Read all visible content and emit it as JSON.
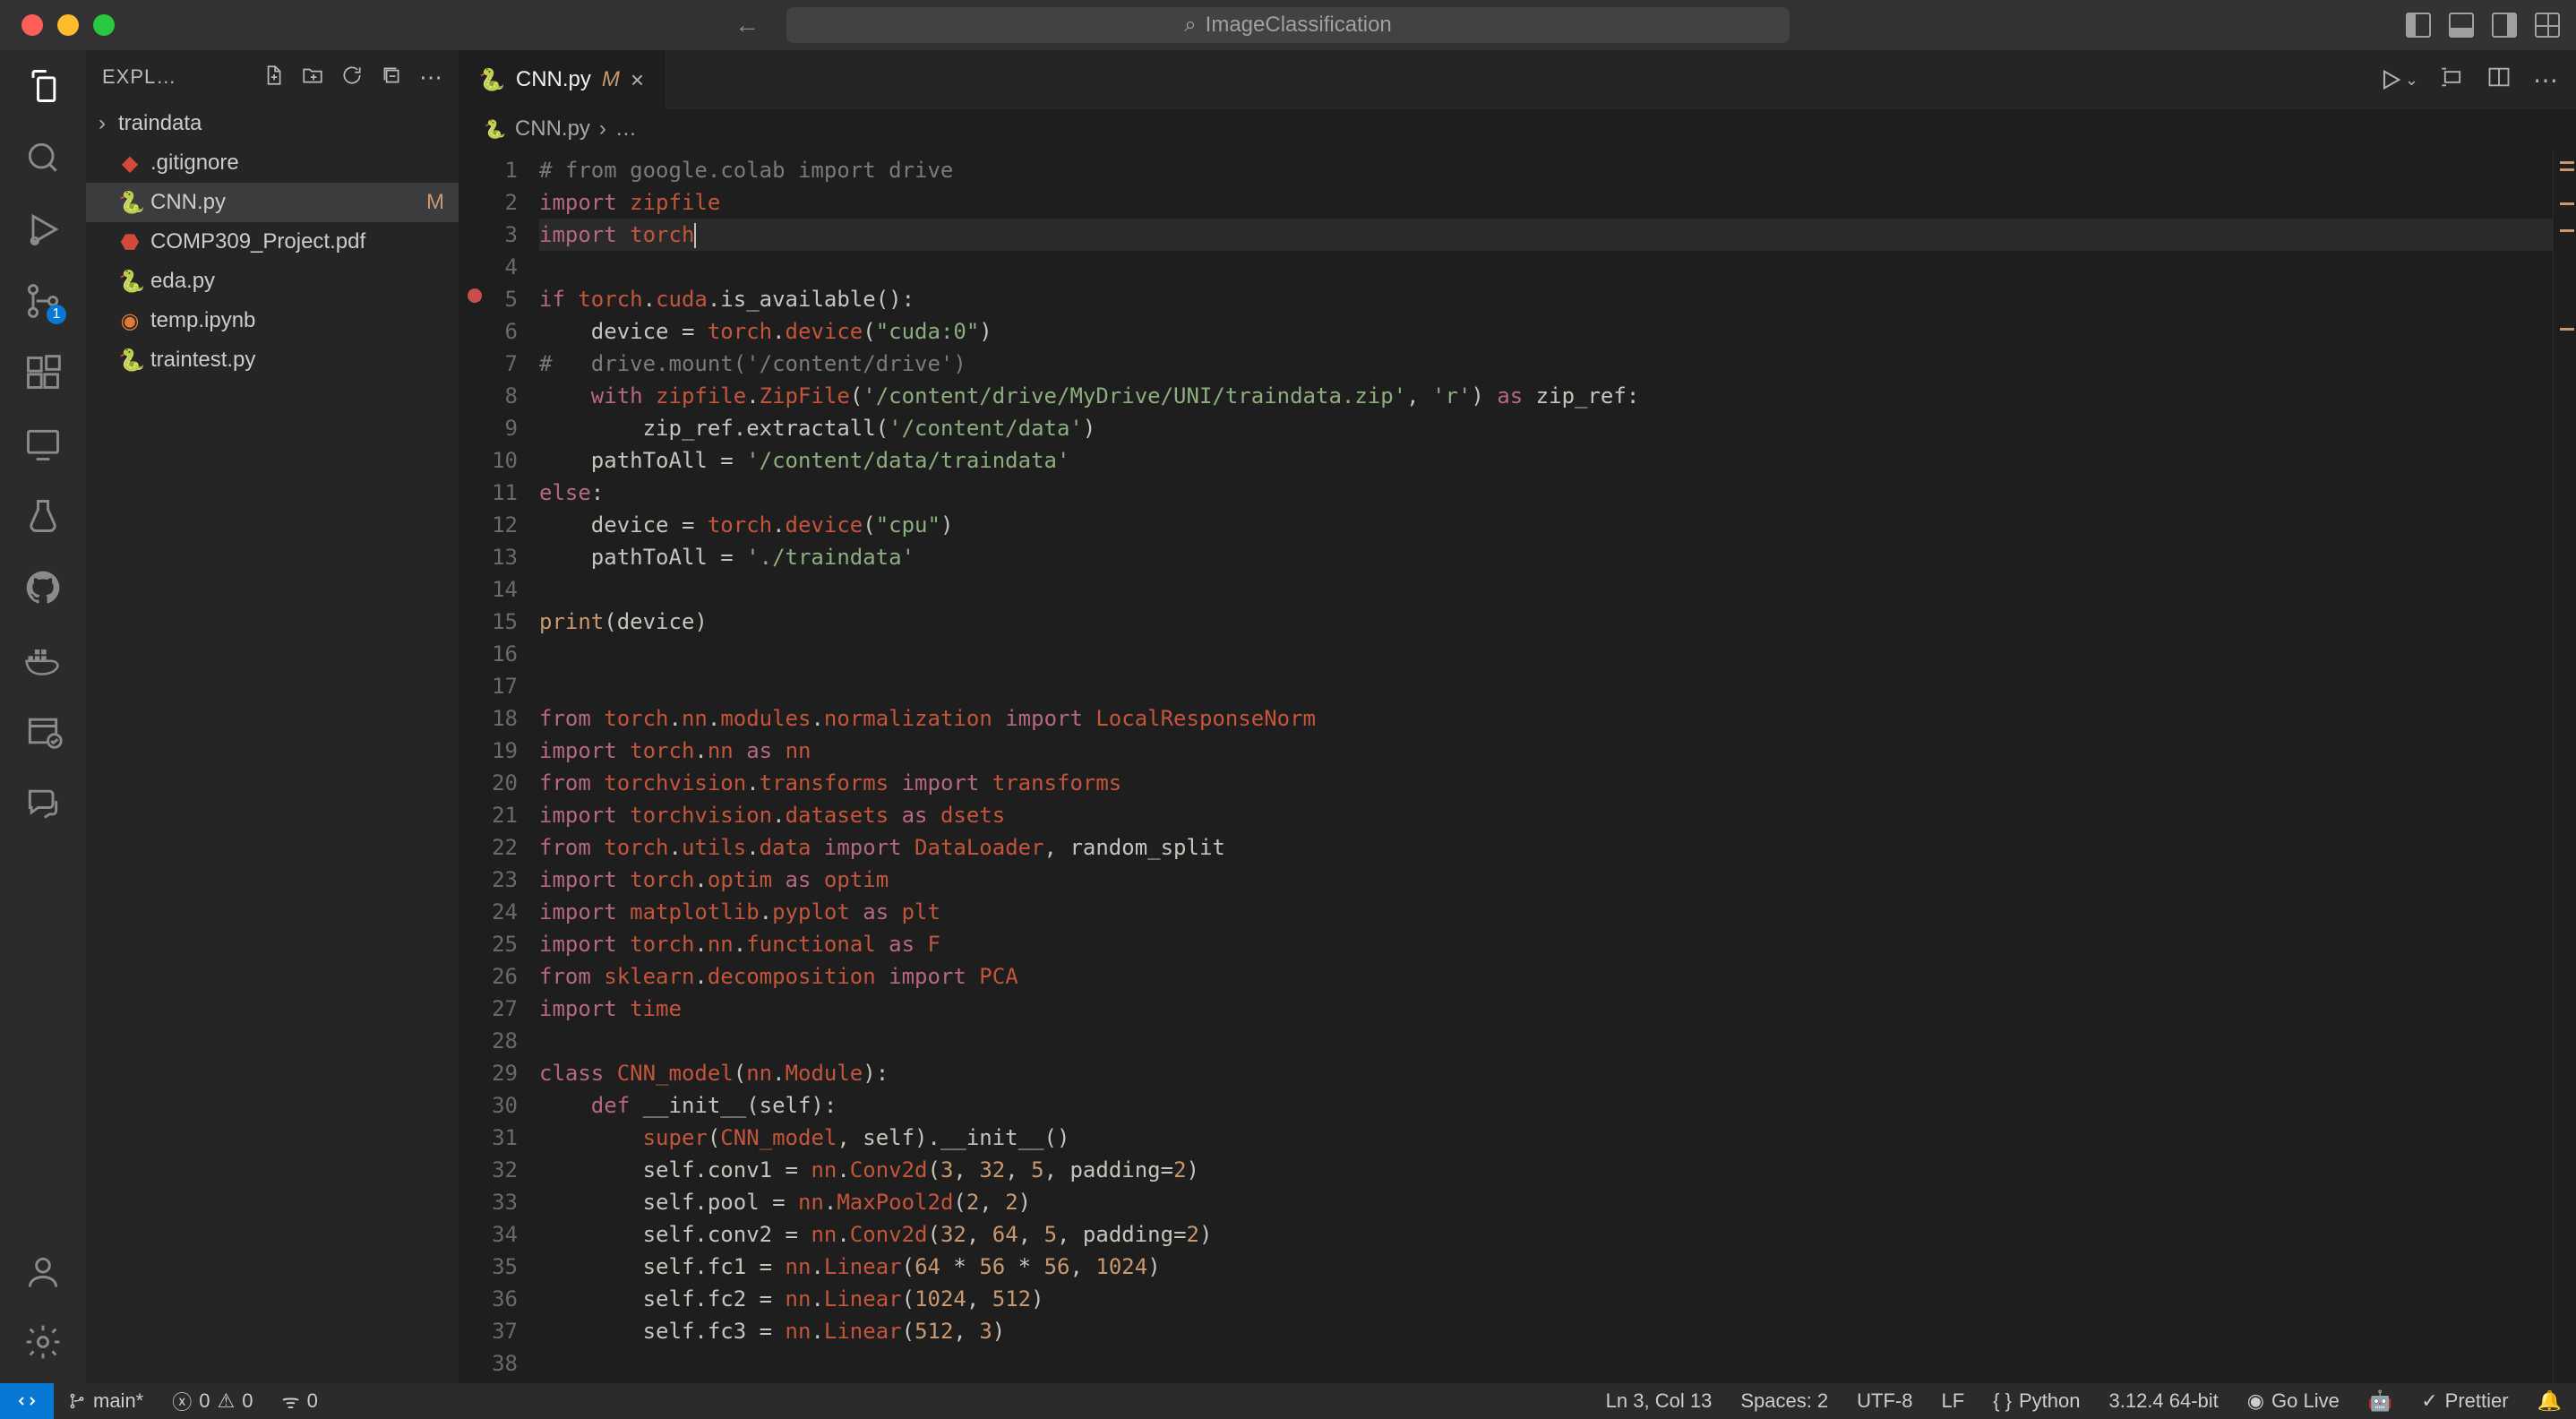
{
  "window": {
    "title": "ImageClassification"
  },
  "activity_bar": {
    "items": [
      "explorer",
      "search",
      "run-debug",
      "source-control",
      "extensions",
      "remote-explorer",
      "testing",
      "github",
      "docker",
      "project-manager",
      "chat"
    ],
    "scm_badge": "1"
  },
  "explorer": {
    "title": "EXPL…",
    "files": [
      {
        "name": "traindata",
        "type": "folder"
      },
      {
        "name": ".gitignore",
        "type": "git"
      },
      {
        "name": "CNN.py",
        "type": "py",
        "active": true,
        "status": "M"
      },
      {
        "name": "COMP309_Project.pdf",
        "type": "pdf"
      },
      {
        "name": "eda.py",
        "type": "py"
      },
      {
        "name": "temp.ipynb",
        "type": "nb"
      },
      {
        "name": "traintest.py",
        "type": "py"
      }
    ]
  },
  "tab": {
    "icon": "python",
    "name": "CNN.py",
    "modified": "M"
  },
  "breadcrumb": {
    "file": "CNN.py",
    "rest": "…"
  },
  "code": {
    "lines": [
      [
        [
          "cmt",
          "# from google.colab import drive"
        ]
      ],
      [
        [
          "kw",
          "import "
        ],
        [
          "red",
          "zipfile"
        ]
      ],
      [
        [
          "kw",
          "import "
        ],
        [
          "red",
          "torch"
        ],
        [
          "caret",
          ""
        ]
      ],
      [],
      [
        [
          "kw",
          "if "
        ],
        [
          "red",
          "torch"
        ],
        [
          "pl",
          "."
        ],
        [
          "red",
          "cuda"
        ],
        [
          "pl",
          ".is_available():"
        ]
      ],
      [
        [
          "pl",
          "    device = "
        ],
        [
          "red",
          "torch"
        ],
        [
          "pl",
          "."
        ],
        [
          "red",
          "device"
        ],
        [
          "pl",
          "("
        ],
        [
          "grn",
          "\"cuda:0\""
        ],
        [
          "pl",
          ")"
        ]
      ],
      [
        [
          "cmt",
          "#   drive.mount('/content/drive')"
        ]
      ],
      [
        [
          "pl",
          "    "
        ],
        [
          "kw",
          "with "
        ],
        [
          "red",
          "zipfile"
        ],
        [
          "pl",
          "."
        ],
        [
          "red",
          "ZipFile"
        ],
        [
          "pl",
          "("
        ],
        [
          "grn",
          "'/content/drive/MyDrive/UNI/traindata.zip'"
        ],
        [
          "pl",
          ", "
        ],
        [
          "grn",
          "'r'"
        ],
        [
          "pl",
          ") "
        ],
        [
          "kw",
          "as"
        ],
        [
          "pl",
          " zip_ref:"
        ]
      ],
      [
        [
          "pl",
          "        zip_ref.extractall("
        ],
        [
          "grn",
          "'/content/data'"
        ],
        [
          "pl",
          ")"
        ]
      ],
      [
        [
          "pl",
          "    pathToAll = "
        ],
        [
          "grn",
          "'/content/data/traindata'"
        ]
      ],
      [
        [
          "kw",
          "else"
        ],
        [
          "pl",
          ":"
        ]
      ],
      [
        [
          "pl",
          "    device = "
        ],
        [
          "red",
          "torch"
        ],
        [
          "pl",
          "."
        ],
        [
          "red",
          "device"
        ],
        [
          "pl",
          "("
        ],
        [
          "grn",
          "\"cpu\""
        ],
        [
          "pl",
          ")"
        ]
      ],
      [
        [
          "pl",
          "    pathToAll = "
        ],
        [
          "grn",
          "'./traindata'"
        ]
      ],
      [],
      [
        [
          "ylw",
          "print"
        ],
        [
          "pl",
          "(device)"
        ]
      ],
      [],
      [],
      [
        [
          "kw",
          "from "
        ],
        [
          "red",
          "torch"
        ],
        [
          "pl",
          "."
        ],
        [
          "red",
          "nn"
        ],
        [
          "pl",
          "."
        ],
        [
          "red",
          "modules"
        ],
        [
          "pl",
          "."
        ],
        [
          "red",
          "normalization"
        ],
        [
          "kw",
          " import "
        ],
        [
          "red",
          "LocalResponseNorm"
        ]
      ],
      [
        [
          "kw",
          "import "
        ],
        [
          "red",
          "torch"
        ],
        [
          "pl",
          "."
        ],
        [
          "red",
          "nn"
        ],
        [
          "kw",
          " as "
        ],
        [
          "red",
          "nn"
        ]
      ],
      [
        [
          "kw",
          "from "
        ],
        [
          "red",
          "torchvision"
        ],
        [
          "pl",
          "."
        ],
        [
          "red",
          "transforms"
        ],
        [
          "kw",
          " import "
        ],
        [
          "red",
          "transforms"
        ]
      ],
      [
        [
          "kw",
          "import "
        ],
        [
          "red",
          "torchvision"
        ],
        [
          "pl",
          "."
        ],
        [
          "red",
          "datasets"
        ],
        [
          "kw",
          " as "
        ],
        [
          "red",
          "dsets"
        ]
      ],
      [
        [
          "kw",
          "from "
        ],
        [
          "red",
          "torch"
        ],
        [
          "pl",
          "."
        ],
        [
          "red",
          "utils"
        ],
        [
          "pl",
          "."
        ],
        [
          "red",
          "data"
        ],
        [
          "kw",
          " import "
        ],
        [
          "red",
          "DataLoader"
        ],
        [
          "pl",
          ", random_split"
        ]
      ],
      [
        [
          "kw",
          "import "
        ],
        [
          "red",
          "torch"
        ],
        [
          "pl",
          "."
        ],
        [
          "red",
          "optim"
        ],
        [
          "kw",
          " as "
        ],
        [
          "red",
          "optim"
        ]
      ],
      [
        [
          "kw",
          "import "
        ],
        [
          "red",
          "matplotlib"
        ],
        [
          "pl",
          "."
        ],
        [
          "red",
          "pyplot"
        ],
        [
          "kw",
          " as "
        ],
        [
          "red",
          "plt"
        ]
      ],
      [
        [
          "kw",
          "import "
        ],
        [
          "red",
          "torch"
        ],
        [
          "pl",
          "."
        ],
        [
          "red",
          "nn"
        ],
        [
          "pl",
          "."
        ],
        [
          "red",
          "functional"
        ],
        [
          "kw",
          " as "
        ],
        [
          "red",
          "F"
        ]
      ],
      [
        [
          "kw",
          "from "
        ],
        [
          "red",
          "sklearn"
        ],
        [
          "pl",
          "."
        ],
        [
          "red",
          "decomposition"
        ],
        [
          "kw",
          " import "
        ],
        [
          "red",
          "PCA"
        ]
      ],
      [
        [
          "kw",
          "import "
        ],
        [
          "red",
          "time"
        ]
      ],
      [],
      [
        [
          "kw",
          "class "
        ],
        [
          "red",
          "CNN_model"
        ],
        [
          "pl",
          "("
        ],
        [
          "red",
          "nn"
        ],
        [
          "pl",
          "."
        ],
        [
          "red",
          "Module"
        ],
        [
          "pl",
          "):"
        ]
      ],
      [
        [
          "pl",
          "    "
        ],
        [
          "kw",
          "def "
        ],
        [
          "pl",
          "__init__(self):"
        ]
      ],
      [
        [
          "pl",
          "        "
        ],
        [
          "red",
          "super"
        ],
        [
          "pl",
          "("
        ],
        [
          "red",
          "CNN_model"
        ],
        [
          "pl",
          ", self).__init__()"
        ]
      ],
      [
        [
          "pl",
          "        self.conv1 = "
        ],
        [
          "red",
          "nn"
        ],
        [
          "pl",
          "."
        ],
        [
          "red",
          "Conv2d"
        ],
        [
          "pl",
          "("
        ],
        [
          "ylw",
          "3"
        ],
        [
          "pl",
          ", "
        ],
        [
          "ylw",
          "32"
        ],
        [
          "pl",
          ", "
        ],
        [
          "ylw",
          "5"
        ],
        [
          "pl",
          ", padding="
        ],
        [
          "ylw",
          "2"
        ],
        [
          "pl",
          ")"
        ]
      ],
      [
        [
          "pl",
          "        self.pool = "
        ],
        [
          "red",
          "nn"
        ],
        [
          "pl",
          "."
        ],
        [
          "red",
          "MaxPool2d"
        ],
        [
          "pl",
          "("
        ],
        [
          "ylw",
          "2"
        ],
        [
          "pl",
          ", "
        ],
        [
          "ylw",
          "2"
        ],
        [
          "pl",
          ")"
        ]
      ],
      [
        [
          "pl",
          "        self.conv2 = "
        ],
        [
          "red",
          "nn"
        ],
        [
          "pl",
          "."
        ],
        [
          "red",
          "Conv2d"
        ],
        [
          "pl",
          "("
        ],
        [
          "ylw",
          "32"
        ],
        [
          "pl",
          ", "
        ],
        [
          "ylw",
          "64"
        ],
        [
          "pl",
          ", "
        ],
        [
          "ylw",
          "5"
        ],
        [
          "pl",
          ", padding="
        ],
        [
          "ylw",
          "2"
        ],
        [
          "pl",
          ")"
        ]
      ],
      [
        [
          "pl",
          "        self.fc1 = "
        ],
        [
          "red",
          "nn"
        ],
        [
          "pl",
          "."
        ],
        [
          "red",
          "Linear"
        ],
        [
          "pl",
          "("
        ],
        [
          "ylw",
          "64"
        ],
        [
          "pl",
          " * "
        ],
        [
          "ylw",
          "56"
        ],
        [
          "pl",
          " * "
        ],
        [
          "ylw",
          "56"
        ],
        [
          "pl",
          ", "
        ],
        [
          "ylw",
          "1024"
        ],
        [
          "pl",
          ")"
        ]
      ],
      [
        [
          "pl",
          "        self.fc2 = "
        ],
        [
          "red",
          "nn"
        ],
        [
          "pl",
          "."
        ],
        [
          "red",
          "Linear"
        ],
        [
          "pl",
          "("
        ],
        [
          "ylw",
          "1024"
        ],
        [
          "pl",
          ", "
        ],
        [
          "ylw",
          "512"
        ],
        [
          "pl",
          ")"
        ]
      ],
      [
        [
          "pl",
          "        self.fc3 = "
        ],
        [
          "red",
          "nn"
        ],
        [
          "pl",
          "."
        ],
        [
          "red",
          "Linear"
        ],
        [
          "pl",
          "("
        ],
        [
          "ylw",
          "512"
        ],
        [
          "pl",
          ", "
        ],
        [
          "ylw",
          "3"
        ],
        [
          "pl",
          ")"
        ]
      ],
      []
    ]
  },
  "status": {
    "branch": "main*",
    "errors": "0",
    "warnings": "0",
    "ports": "0",
    "ln_col": "Ln 3, Col 13",
    "spaces": "Spaces: 2",
    "encoding": "UTF-8",
    "eol": "LF",
    "lang": "Python",
    "interp": "3.12.4 64-bit",
    "golive": "Go Live",
    "prettier": "Prettier"
  }
}
